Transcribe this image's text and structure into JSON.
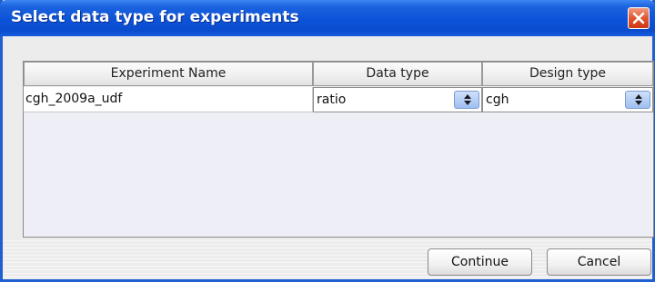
{
  "window": {
    "title": "Select data type for experiments"
  },
  "table": {
    "columns": [
      "Experiment Name",
      "Data type",
      "Design type"
    ],
    "rows": [
      {
        "experiment_name": "cgh_2009a_udf",
        "data_type": "ratio",
        "design_type": "cgh"
      }
    ]
  },
  "buttons": {
    "continue_label": "Continue",
    "cancel_label": "Cancel"
  },
  "icons": {
    "close": "close-icon",
    "combo_arrow": "up-down-arrow-icon"
  },
  "colors": {
    "title_bar": "#0c52d8",
    "close_button": "#e2552f",
    "table_background": "#eeeef6"
  }
}
